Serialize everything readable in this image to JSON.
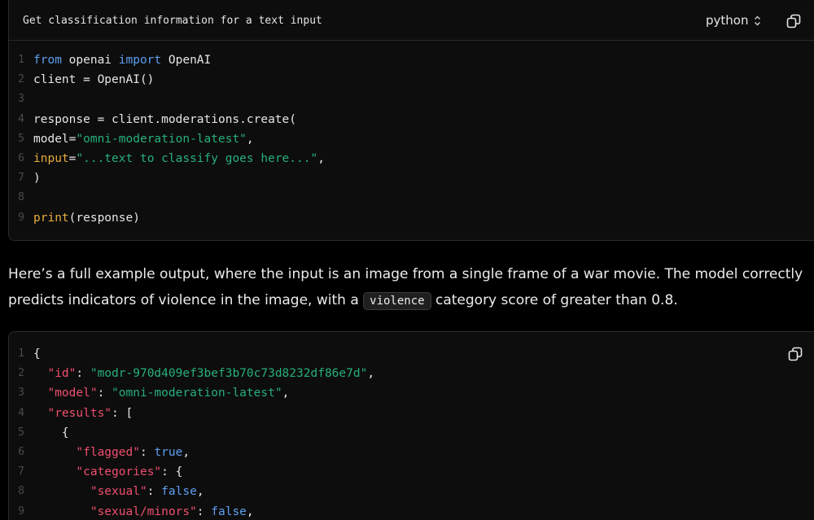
{
  "block1": {
    "title": "Get classification information for a text input",
    "language": "python",
    "lines": [
      {
        "n": "1",
        "tokens": [
          {
            "t": "from",
            "c": "kw"
          },
          {
            "t": " openai ",
            "c": "plain"
          },
          {
            "t": "import",
            "c": "kw"
          },
          {
            "t": " OpenAI",
            "c": "plain"
          }
        ]
      },
      {
        "n": "2",
        "tokens": [
          {
            "t": "client = OpenAI()",
            "c": "plain"
          }
        ]
      },
      {
        "n": "3",
        "tokens": []
      },
      {
        "n": "4",
        "tokens": [
          {
            "t": "response = client.moderations.create(",
            "c": "plain"
          }
        ]
      },
      {
        "n": "5",
        "tokens": [
          {
            "t": "model=",
            "c": "plain"
          },
          {
            "t": "\"omni-moderation-latest\"",
            "c": "str"
          },
          {
            "t": ",",
            "c": "plain"
          }
        ]
      },
      {
        "n": "6",
        "tokens": [
          {
            "t": "input",
            "c": "fn"
          },
          {
            "t": "=",
            "c": "plain"
          },
          {
            "t": "\"...text to classify goes here...\"",
            "c": "str"
          },
          {
            "t": ",",
            "c": "plain"
          }
        ]
      },
      {
        "n": "7",
        "tokens": [
          {
            "t": ")",
            "c": "plain"
          }
        ]
      },
      {
        "n": "8",
        "tokens": []
      },
      {
        "n": "9",
        "tokens": [
          {
            "t": "print",
            "c": "fn"
          },
          {
            "t": "(response)",
            "c": "plain"
          }
        ]
      }
    ]
  },
  "prose": {
    "part1": "Here’s a full example output, where the input is an image from a single frame of a war movie. The model correctly predicts indicators of violence in the image, with a ",
    "code": "violence",
    "part2": " category score of greater than 0.8."
  },
  "block2": {
    "lines": [
      {
        "n": "1",
        "tokens": [
          {
            "t": "{",
            "c": "plain"
          }
        ]
      },
      {
        "n": "2",
        "tokens": [
          {
            "t": "  ",
            "c": "plain"
          },
          {
            "t": "\"id\"",
            "c": "key"
          },
          {
            "t": ": ",
            "c": "plain"
          },
          {
            "t": "\"modr-970d409ef3bef3b70c73d8232df86e7d\"",
            "c": "str"
          },
          {
            "t": ",",
            "c": "plain"
          }
        ]
      },
      {
        "n": "3",
        "tokens": [
          {
            "t": "  ",
            "c": "plain"
          },
          {
            "t": "\"model\"",
            "c": "key"
          },
          {
            "t": ": ",
            "c": "plain"
          },
          {
            "t": "\"omni-moderation-latest\"",
            "c": "str"
          },
          {
            "t": ",",
            "c": "plain"
          }
        ]
      },
      {
        "n": "4",
        "tokens": [
          {
            "t": "  ",
            "c": "plain"
          },
          {
            "t": "\"results\"",
            "c": "key"
          },
          {
            "t": ": [",
            "c": "plain"
          }
        ]
      },
      {
        "n": "5",
        "tokens": [
          {
            "t": "    {",
            "c": "plain"
          }
        ]
      },
      {
        "n": "6",
        "tokens": [
          {
            "t": "      ",
            "c": "plain"
          },
          {
            "t": "\"flagged\"",
            "c": "key"
          },
          {
            "t": ": ",
            "c": "plain"
          },
          {
            "t": "true",
            "c": "bool"
          },
          {
            "t": ",",
            "c": "plain"
          }
        ]
      },
      {
        "n": "7",
        "tokens": [
          {
            "t": "      ",
            "c": "plain"
          },
          {
            "t": "\"categories\"",
            "c": "key"
          },
          {
            "t": ": {",
            "c": "plain"
          }
        ]
      },
      {
        "n": "8",
        "tokens": [
          {
            "t": "        ",
            "c": "plain"
          },
          {
            "t": "\"sexual\"",
            "c": "key"
          },
          {
            "t": ": ",
            "c": "plain"
          },
          {
            "t": "false",
            "c": "bool"
          },
          {
            "t": ",",
            "c": "plain"
          }
        ]
      },
      {
        "n": "9",
        "tokens": [
          {
            "t": "        ",
            "c": "plain"
          },
          {
            "t": "\"sexual/minors\"",
            "c": "key"
          },
          {
            "t": ": ",
            "c": "plain"
          },
          {
            "t": "false",
            "c": "bool"
          },
          {
            "t": ",",
            "c": "plain"
          }
        ]
      }
    ]
  },
  "icons": {
    "copy": "copy-icon",
    "lang_toggle": "chevron-up-down-icon"
  },
  "colors": {
    "keyword": "#5ea0f0",
    "function": "#e7ad3e",
    "string": "#26b07a",
    "json_key": "#ef4f6e"
  }
}
